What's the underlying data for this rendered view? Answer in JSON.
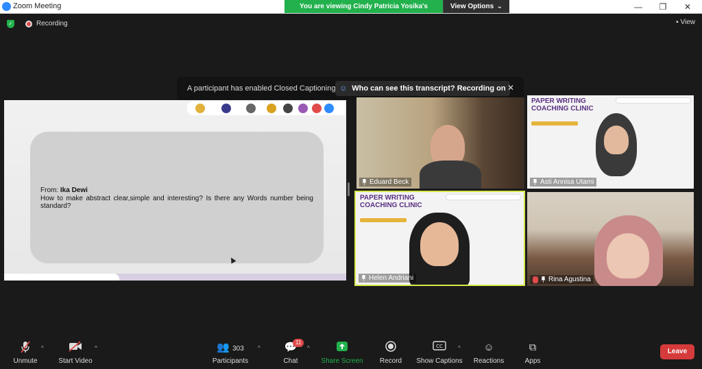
{
  "window": {
    "title": "Zoom Meeting",
    "controls": [
      "—",
      "❐",
      "✕"
    ]
  },
  "viewing_banner": {
    "text": "You are viewing Cindy Patricia Yosika's screen",
    "options_label": "View Options"
  },
  "topbar": {
    "recording_label": "Recording",
    "view_label": "View"
  },
  "toast": {
    "message": "A participant has enabled Closed Captioning",
    "button_label": "Who can see this transcript? Recording on",
    "close": "✕"
  },
  "shared_screen": {
    "from_label": "From:",
    "from_name": "Ika Dewi",
    "question": "How to make abstract clear,simple and interesting? Is there any Words number being standard?"
  },
  "participants": [
    {
      "name": "Eduard Beck"
    },
    {
      "name": "Asti Annisa Utami"
    },
    {
      "name": "Helen Andriani"
    },
    {
      "name": "Rina Agustina"
    }
  ],
  "slide": {
    "title_line1": "PAPER WRITING",
    "title_line2": "COACHING CLINIC"
  },
  "toolbar": {
    "unmute": "Unmute",
    "start_video": "Start Video",
    "participants": "Participants",
    "participants_count": "303",
    "chat": "Chat",
    "chat_badge": "11",
    "share_screen": "Share Screen",
    "record": "Record",
    "show_captions": "Show Captions",
    "reactions": "Reactions",
    "apps": "Apps",
    "leave": "Leave"
  },
  "colors": {
    "accent_green": "#22b14c",
    "leave_red": "#d63b3b",
    "active_speaker_border": "#d7e84a",
    "slide_purple": "#5a2f83"
  }
}
